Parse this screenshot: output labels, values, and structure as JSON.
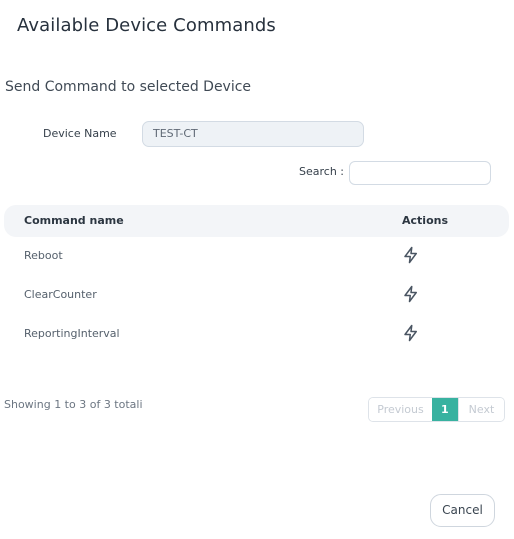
{
  "dialog": {
    "title": "Available Device Commands",
    "subtitle": "Send Command to selected Device"
  },
  "form": {
    "device_name_label": "Device Name",
    "device_name_value": "TEST-CT",
    "search_label": "Search :",
    "search_value": ""
  },
  "table": {
    "columns": [
      "Command name",
      "Actions"
    ],
    "rows": [
      {
        "name": "Reboot",
        "action_icon": "lightning-icon"
      },
      {
        "name": "ClearCounter",
        "action_icon": "lightning-icon"
      },
      {
        "name": "ReportingInterval",
        "action_icon": "lightning-icon"
      }
    ]
  },
  "pagination": {
    "showing_text": "Showing 1 to 3 of 3 totali",
    "previous_label": "Previous",
    "current_page": "1",
    "next_label": "Next"
  },
  "footer": {
    "cancel_label": "Cancel"
  },
  "colors": {
    "accent": "#38b2a0",
    "header_bg": "#f3f5f8",
    "input_disabled_bg": "#eef2f6"
  }
}
